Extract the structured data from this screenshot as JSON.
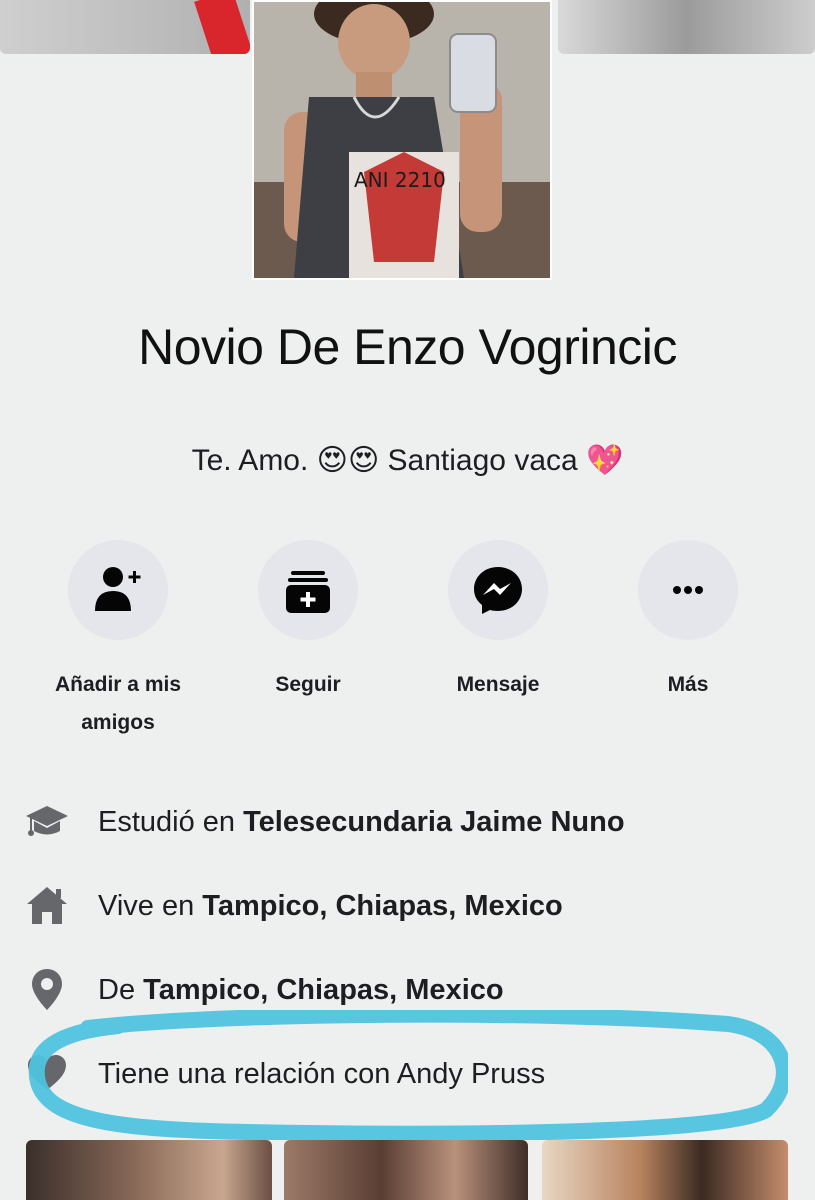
{
  "profile": {
    "name": "Novio De Enzo Vogrincic",
    "bio_text": "Te. Amo. 😍😍 Santiago vaca 💖"
  },
  "actions": [
    {
      "label": "Añadir a mis amigos",
      "icon": "add-friend-icon"
    },
    {
      "label": "Seguir",
      "icon": "follow-icon"
    },
    {
      "label": "Mensaje",
      "icon": "messenger-icon"
    },
    {
      "label": "Más",
      "icon": "more-icon"
    }
  ],
  "info": {
    "studied": {
      "prefix": "Estudió en ",
      "value": "Telesecundaria Jaime Nuno",
      "icon": "graduation-cap-icon"
    },
    "lives": {
      "prefix": "Vive en ",
      "value": "Tampico, Chiapas, Mexico",
      "icon": "home-icon"
    },
    "from": {
      "prefix": "De ",
      "value": "Tampico, Chiapas, Mexico",
      "icon": "location-pin-icon"
    },
    "relationship": {
      "text": "Tiene una relación con Andy Pruss",
      "icon": "heart-icon"
    }
  },
  "colors": {
    "background": "#eef0ef",
    "action_circle": "#e4e6eb",
    "icon_dark": "#050505",
    "info_icon": "#65676b",
    "highlight_marker": "#4fc3df"
  }
}
